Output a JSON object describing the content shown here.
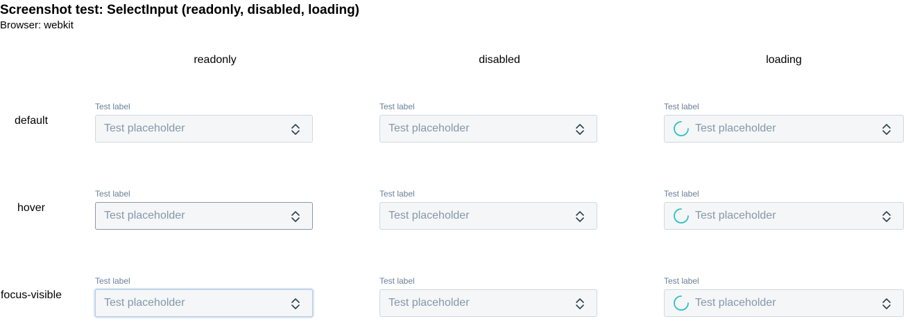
{
  "header": {
    "title": "Screenshot test: SelectInput (readonly, disabled, loading)",
    "subtitle": "Browser: webkit"
  },
  "columns": [
    "readonly",
    "disabled",
    "loading"
  ],
  "rows": [
    "default",
    "hover",
    "focus-visible"
  ],
  "field": {
    "label": "Test label",
    "placeholder": "Test placeholder"
  },
  "icons": {
    "chevron": "chevron-up-down-icon",
    "spinner": "loading-spinner-icon"
  },
  "colors": {
    "spinner": "#2fbfc4",
    "label": "#6a7f96",
    "placeholder": "#8697a8"
  }
}
